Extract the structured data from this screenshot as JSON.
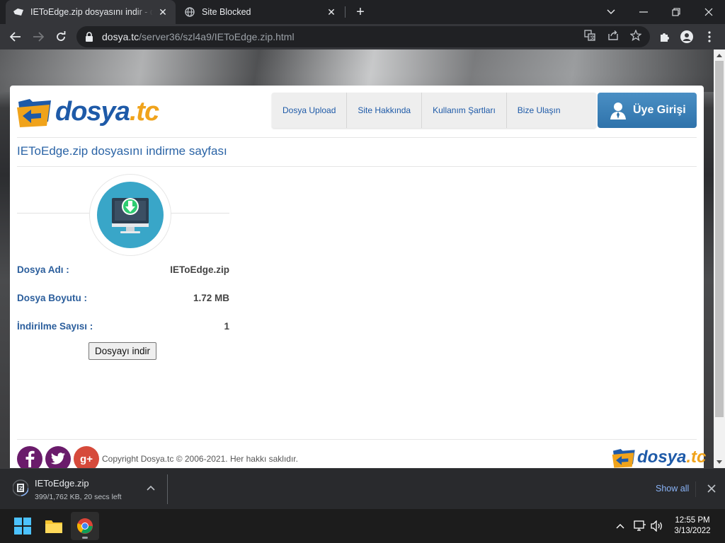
{
  "browser": {
    "tabs": [
      {
        "title": "IEToEdge.zip dosyasını indir - dosya.tc",
        "active": true
      },
      {
        "title": "Site Blocked",
        "active": false
      }
    ],
    "url_host": "dosya.tc",
    "url_path": "/server36/szl4a9/IEToEdge.zip.html"
  },
  "site": {
    "logo_text": "dosya",
    "logo_tld": ".tc",
    "nav": [
      "Dosya Upload",
      "Site Hakkında",
      "Kullanım Şartları",
      "Bize Ulaşın"
    ],
    "login_label": "Üye Girişi",
    "page_title": "IEToEdge.zip dosyasını indirme sayfası",
    "info": [
      {
        "label": "Dosya Adı :",
        "value": "IEToEdge.zip"
      },
      {
        "label": "Dosya Boyutu :",
        "value": "1.72 MB"
      },
      {
        "label": "İndirilme Sayısı :",
        "value": "1"
      }
    ],
    "download_button": "Dosyayı indir",
    "copyright": "Copyright Dosya.tc © 2006-2021. Her hakkı saklıdır.",
    "social": [
      "facebook-icon",
      "twitter-icon",
      "google-plus-icon"
    ]
  },
  "download_shelf": {
    "file_name": "IEToEdge.zip",
    "status": "399/1,762 KB, 20 secs left",
    "show_all": "Show all"
  },
  "taskbar": {
    "time": "12:55 PM",
    "date": "3/13/2022"
  },
  "colors": {
    "brand_blue": "#1e5aa8",
    "brand_orange": "#f0a31b",
    "icon_teal": "#39a6c8",
    "facebook": "#6a1b6b",
    "twitter": "#6a1b6b",
    "google": "#d64a3b"
  }
}
